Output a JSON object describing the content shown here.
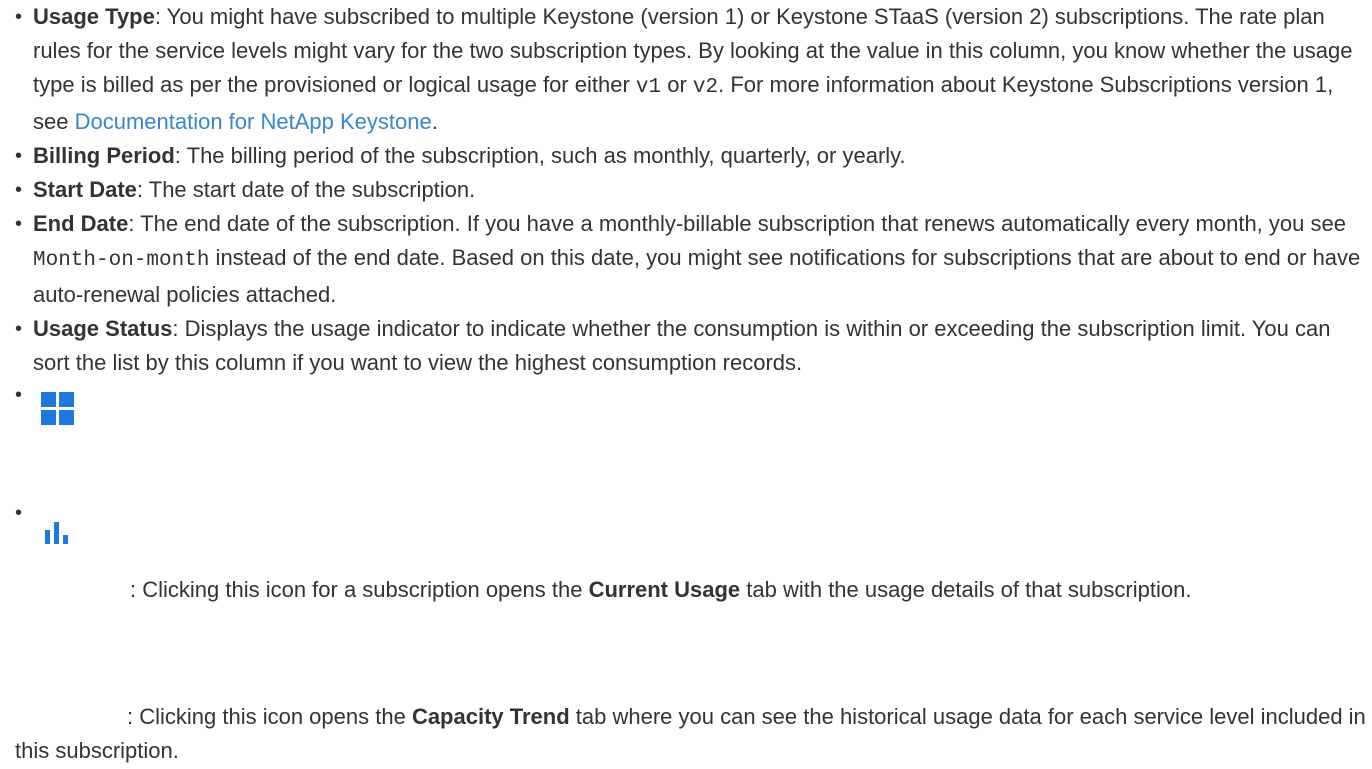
{
  "items": [
    {
      "term": "Usage Type",
      "text_before_v1": ": You might have subscribed to multiple Keystone (version 1) or Keystone STaaS (version 2) subscriptions. The rate plan rules for the service levels might vary for the two subscription types. By looking at the value in this column, you know whether the usage type is billed as per the provisioned or logical usage for either ",
      "code_v1": "v1",
      "text_or": " or ",
      "code_v2": "v2",
      "text_after_v2": ". For more information about Keystone Subscriptions version 1, see ",
      "link_text": "Documentation for NetApp Keystone",
      "text_end": "."
    },
    {
      "term": "Billing Period",
      "text": ": The billing period of the subscription, such as monthly, quarterly, or yearly."
    },
    {
      "term": "Start Date",
      "text": ": The start date of the subscription."
    },
    {
      "term": "End Date",
      "text_before_code": ": The end date of the subscription. If you have a monthly-billable subscription that renews automatically every month, you see ",
      "code": "Month-on-month",
      "text_after_code": " instead of the end date. Based on this date, you might see notifications for subscriptions that are about to end or have auto-renewal policies attached."
    },
    {
      "term": "Usage Status",
      "text": ": Displays the usage indicator to indicate whether the consumption is within or exceeding the subscription limit. You can sort the list by this column if you want to view the highest consumption records."
    },
    {
      "icon": "grid-icon",
      "text_before_bold": ": Clicking this icon for a subscription opens the ",
      "bold": "Current Usage",
      "text_after_bold": " tab with the usage details of that subscription."
    },
    {
      "icon": "bar-chart-icon",
      "text_before_bold": ": Clicking this icon opens the ",
      "bold": "Capacity Trend",
      "text_after_bold": " tab where you can see the historical usage data for each service level included in this subscription."
    }
  ],
  "colors": {
    "text": "#333333",
    "link": "#3a86c8",
    "icon": "#1e78d8"
  }
}
